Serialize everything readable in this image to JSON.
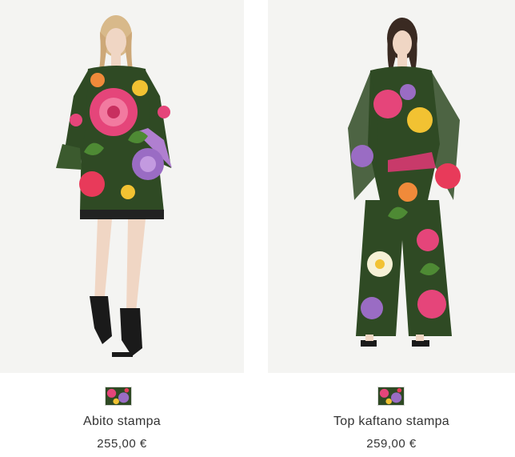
{
  "products": [
    {
      "name": "Abito stampa",
      "price": "255,00 €",
      "image_alt": "Model wearing floral print dress",
      "swatch": "floral-print"
    },
    {
      "name": "Top kaftano stampa",
      "price": "259,00 €",
      "image_alt": "Model wearing floral print kaftan top and trousers",
      "swatch": "floral-print"
    }
  ],
  "colors": {
    "photo_bg": "#f4f4f2",
    "print_green": "#2f4a24",
    "print_pink": "#e5457a",
    "print_purple": "#9a6cc4",
    "print_yellow": "#f2c232"
  }
}
